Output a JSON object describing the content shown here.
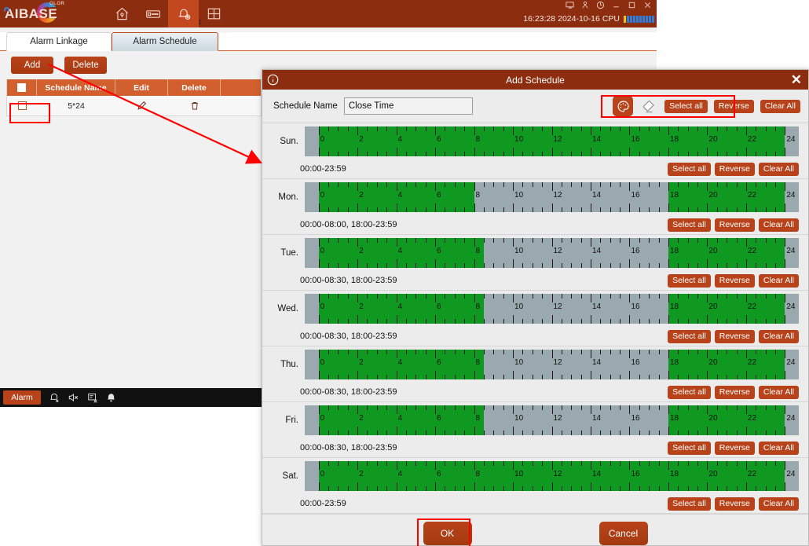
{
  "app": {
    "logo_text": "AIBASE",
    "logo_sub": "OLOR",
    "nav": [
      {
        "name": "home-icon",
        "label": "Home"
      },
      {
        "name": "device-icon",
        "label": "Device"
      },
      {
        "name": "alarm-settings-icon",
        "label": "Alarm"
      },
      {
        "name": "layout-grid-icon",
        "label": "Layout"
      }
    ],
    "nav_badge": "1",
    "window_controls": [
      {
        "name": "monitor-icon"
      },
      {
        "name": "user-icon"
      },
      {
        "name": "power-icon"
      },
      {
        "name": "minimize-icon"
      },
      {
        "name": "maximize-icon"
      },
      {
        "name": "close-icon"
      }
    ],
    "status": {
      "time": "16:23:28",
      "date": "2024-10-16",
      "cpu_label": "CPU",
      "cpu_bars": 10,
      "cpu_hot_index": 0
    },
    "tabs": [
      {
        "label": "Alarm Linkage",
        "active": false
      },
      {
        "label": "Alarm Schedule",
        "active": true
      }
    ],
    "toolbar": {
      "add_label": "Add",
      "delete_label": "Delete"
    },
    "table": {
      "headers": [
        "",
        "Schedule Name",
        "Edit",
        "Delete",
        ""
      ],
      "rows": [
        {
          "name": "5*24",
          "edit_icon": "pencil-icon",
          "delete_icon": "trash-icon"
        }
      ]
    },
    "alarmbar": {
      "label": "Alarm",
      "icons": [
        "alarm-off-icon",
        "speaker-mute-icon",
        "screen-off-icon",
        "bell-icon"
      ]
    }
  },
  "dialog": {
    "title": "Add Schedule",
    "info_icon": "info-icon",
    "close_icon": "close-icon",
    "name_label": "Schedule Name",
    "name_value": "Close Time",
    "name_placeholder": "Schedule Name",
    "paint_icon": "palette-icon",
    "eraser_icon": "eraser-icon",
    "global_buttons": {
      "select_all": "Select all",
      "reverse": "Reverse",
      "clear_all": "Clear All"
    },
    "row_buttons": {
      "select_all": "Select all",
      "reverse": "Reverse",
      "clear_all": "Clear All"
    },
    "footer": {
      "ok": "OK",
      "cancel": "Cancel"
    },
    "axis_ticks": [
      "0",
      "2",
      "4",
      "6",
      "8",
      "10",
      "12",
      "14",
      "16",
      "18",
      "20",
      "22",
      "24"
    ],
    "days": [
      {
        "label": "Sun.",
        "range_text": "00:00-23:59",
        "segments": [
          {
            "start": 0,
            "end": 24
          }
        ]
      },
      {
        "label": "Mon.",
        "range_text": "00:00-08:00, 18:00-23:59",
        "segments": [
          {
            "start": 0,
            "end": 8
          },
          {
            "start": 18,
            "end": 24
          }
        ]
      },
      {
        "label": "Tue.",
        "range_text": "00:00-08:30, 18:00-23:59",
        "segments": [
          {
            "start": 0,
            "end": 8.5
          },
          {
            "start": 18,
            "end": 24
          }
        ]
      },
      {
        "label": "Wed.",
        "range_text": "00:00-08:30, 18:00-23:59",
        "segments": [
          {
            "start": 0,
            "end": 8.5
          },
          {
            "start": 18,
            "end": 24
          }
        ]
      },
      {
        "label": "Thu.",
        "range_text": "00:00-08:30, 18:00-23:59",
        "segments": [
          {
            "start": 0,
            "end": 8.5
          },
          {
            "start": 18,
            "end": 24
          }
        ]
      },
      {
        "label": "Fri.",
        "range_text": "00:00-08:30, 18:00-23:59",
        "segments": [
          {
            "start": 0,
            "end": 8.5
          },
          {
            "start": 18,
            "end": 24
          }
        ]
      },
      {
        "label": "Sat.",
        "range_text": "00:00-23:59",
        "segments": [
          {
            "start": 0,
            "end": 24
          }
        ]
      }
    ]
  },
  "colors": {
    "brand_dark": "#8c2d10",
    "brand": "#b8431b",
    "selected_green": "#0f9920",
    "unselected_gray": "#9aa8b0",
    "annotation_red": "#ff0000"
  }
}
